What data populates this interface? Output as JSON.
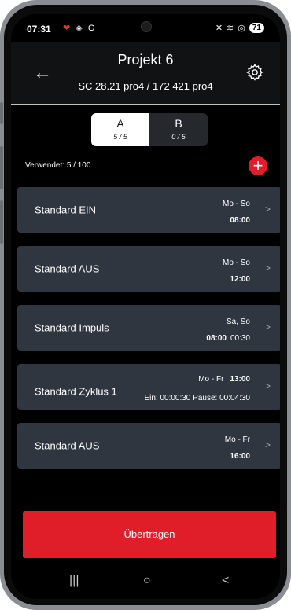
{
  "status": {
    "time": "07:31",
    "left_icons": "G",
    "battery": "71"
  },
  "header": {
    "title": "Projekt 6",
    "subtitle": "SC 28.21 pro4 / 172 421 pro4"
  },
  "tabs": [
    {
      "label": "A",
      "count": "5 / 5"
    },
    {
      "label": "B",
      "count": "0 / 5"
    }
  ],
  "used_text": "Verwendet:  5 / 100",
  "programs": [
    {
      "name": "Standard EIN",
      "days": "Mo - So",
      "time": "08:00"
    },
    {
      "name": "Standard AUS",
      "days": "Mo - So",
      "time": "12:00"
    },
    {
      "name": "Standard Impuls",
      "days": "Sa, So",
      "time": "08:00",
      "duration": "00:30"
    },
    {
      "name": "Standard Zyklus 1",
      "days": "Mo - Fr",
      "time": "13:00",
      "detail": "Ein: 00:00:30  Pause: 00:04:30"
    },
    {
      "name": "Standard AUS",
      "days": "Mo - Fr",
      "time": "16:00"
    }
  ],
  "transfer_label": "Übertragen",
  "colors": {
    "accent": "#e01e2a",
    "card": "#2f3640",
    "background": "#000000"
  }
}
